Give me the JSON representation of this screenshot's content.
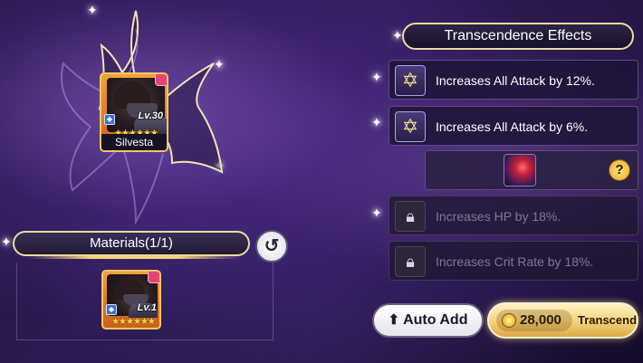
{
  "hero": {
    "name": "Silvesta",
    "level": "Lv.30",
    "stars": "★★★★★★"
  },
  "materials": {
    "title": "Materials(1/1)",
    "card": {
      "level": "Lv.1",
      "stars": "★★★★★★"
    }
  },
  "effects": {
    "title": "Transcendence Effects",
    "items": [
      {
        "text": "Increases All Attack by 12%.",
        "icon": "star-icon",
        "locked": false
      },
      {
        "text": "Increases All Attack by 6%.",
        "icon": "star-icon",
        "locked": false
      },
      {
        "text": "Increases HP by 18%.",
        "icon": "lock-icon",
        "locked": true
      },
      {
        "text": "Increases Crit Rate by 18%.",
        "icon": "lock-icon",
        "locked": true
      }
    ],
    "help_label": "?"
  },
  "buttons": {
    "auto_add": "Auto Add",
    "cost": "28,000",
    "transcend": "Transcend"
  },
  "colors": {
    "accent_gold": "#e9dca0",
    "background": "#2c1a52"
  }
}
